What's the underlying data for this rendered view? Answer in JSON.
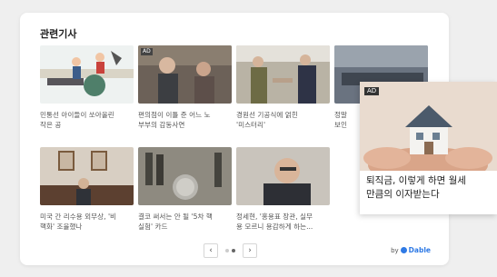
{
  "widget": {
    "title": "관련기사"
  },
  "ad_label": "AD",
  "articles": [
    {
      "caption": "민통선 아이들이 쏘아올린\n작은 공",
      "image": "illustration-children",
      "ad": false
    },
    {
      "caption": "편의점이 이틀 준 어느 노\n부부의 감동사연",
      "image": "elderly-couple-photo",
      "ad": true
    },
    {
      "caption": "경원선 기공식에 얽힌\n'미스터리'",
      "image": "ceremony-handshake-photo",
      "ad": false
    },
    {
      "caption": "정말\n보인",
      "image": "meeting-room-photo",
      "ad": false
    },
    {
      "caption": "미국 간 리수용 외무상, '비\n핵화' 조율했나",
      "image": "official-portraits-photo",
      "ad": false
    },
    {
      "caption": "결코 써서는 안 될 '5차 핵\n실험' 카드",
      "image": "nuclear-device-photo",
      "ad": false
    },
    {
      "caption": "정세현, '홍용표 장관, 실무\n용 모르니 용감하게 하는...",
      "image": "speaker-portrait-photo",
      "ad": false
    }
  ],
  "pagination": {
    "prev_icon": "‹",
    "next_icon": "›",
    "pages": 2,
    "current": 2
  },
  "branding": {
    "by": "by",
    "name": "Dable"
  },
  "popup_ad": {
    "label": "AD",
    "image": "house-in-hands-photo",
    "text": "퇴직금, 이렇게 하면 월세\n만큼의 이자받는다"
  }
}
